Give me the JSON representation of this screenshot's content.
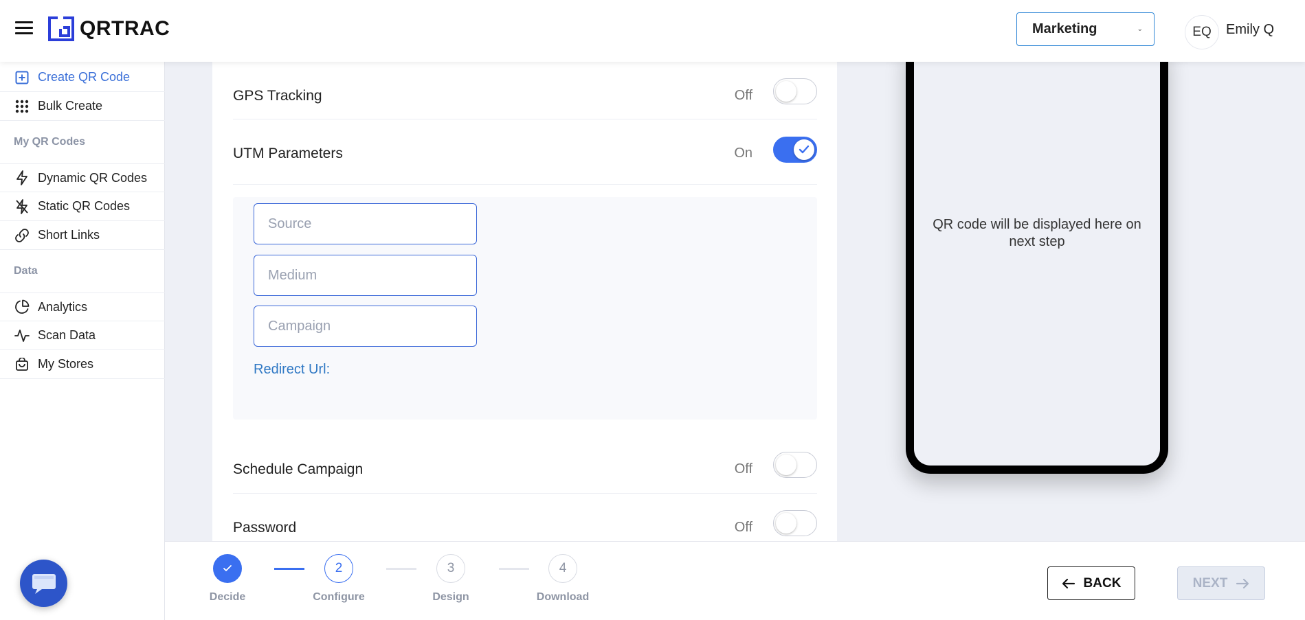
{
  "header": {
    "logo_text": "QRTRAC",
    "workspace": "Marketing",
    "avatar_initials": "EQ",
    "user_name": "Emily Q"
  },
  "sidebar": {
    "items_top": [
      {
        "label": "Create QR Code",
        "icon": "plus-square-icon",
        "active": true
      },
      {
        "label": "Bulk Create",
        "icon": "grid-dots-icon",
        "active": false
      }
    ],
    "section_my_qr": "My QR Codes",
    "items_my_qr": [
      {
        "label": "Dynamic QR Codes",
        "icon": "lightning-icon"
      },
      {
        "label": "Static QR Codes",
        "icon": "lightning-off-icon"
      },
      {
        "label": "Short Links",
        "icon": "link-icon"
      }
    ],
    "section_data": "Data",
    "items_data": [
      {
        "label": "Analytics",
        "icon": "pie-chart-icon"
      },
      {
        "label": "Scan Data",
        "icon": "activity-icon"
      },
      {
        "label": "My Stores",
        "icon": "shopping-bag-icon"
      }
    ]
  },
  "form": {
    "gps": {
      "label": "GPS Tracking",
      "state": "Off"
    },
    "utm": {
      "label": "UTM Parameters",
      "state": "On"
    },
    "utm_fields": {
      "source_placeholder": "Source",
      "medium_placeholder": "Medium",
      "campaign_placeholder": "Campaign"
    },
    "redirect_label": "Redirect Url:",
    "schedule": {
      "label": "Schedule Campaign",
      "state": "Off"
    },
    "password": {
      "label": "Password",
      "state": "Off"
    }
  },
  "preview": {
    "note": "QR code will be displayed here on next step"
  },
  "stepper": {
    "steps": [
      {
        "number": "1",
        "name": "Decide",
        "status": "done"
      },
      {
        "number": "2",
        "name": "Configure",
        "status": "current"
      },
      {
        "number": "3",
        "name": "Design",
        "status": "pending"
      },
      {
        "number": "4",
        "name": "Download",
        "status": "pending"
      }
    ],
    "back_label": "BACK",
    "next_label": "NEXT"
  },
  "colors": {
    "accent": "#3a6ff0",
    "link": "#2f78c4",
    "chat": "#2d55c9"
  }
}
